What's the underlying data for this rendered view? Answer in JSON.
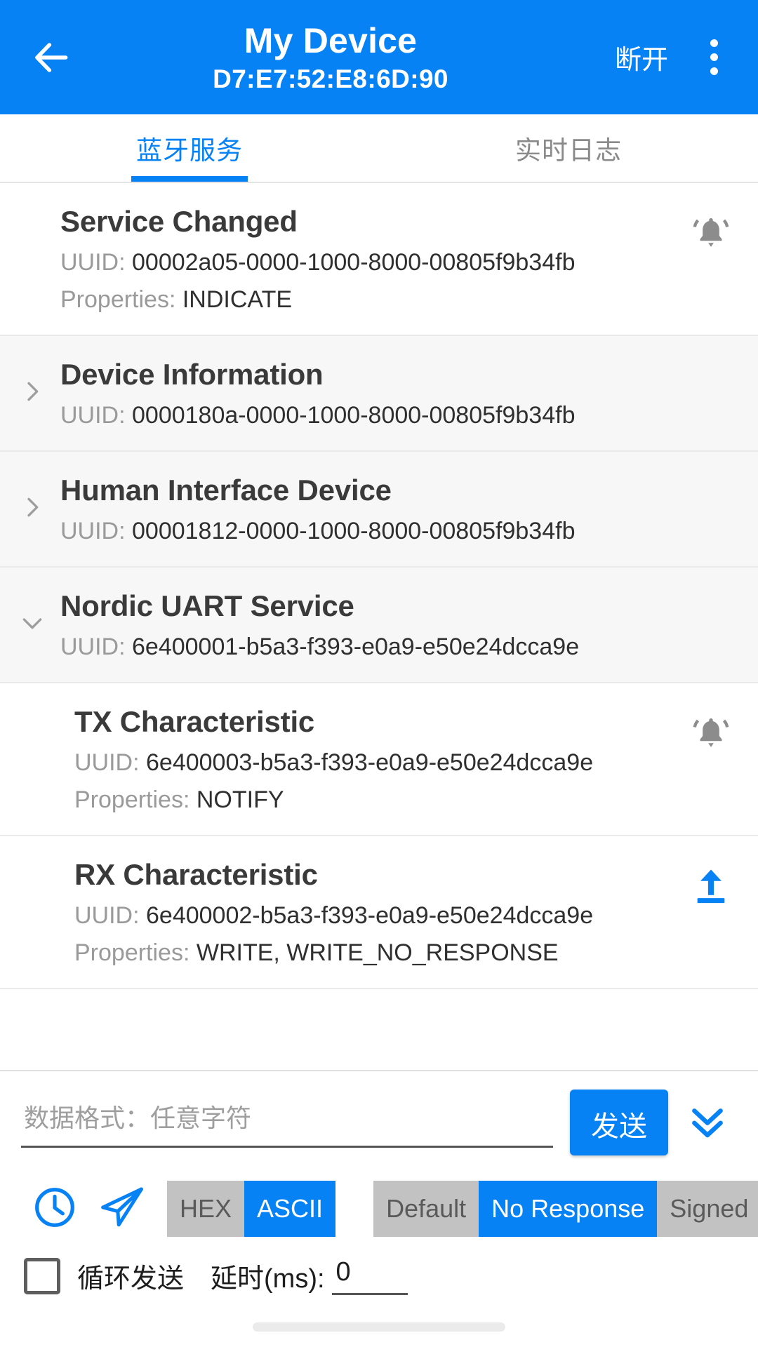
{
  "appbar": {
    "back_icon": "arrow-left-icon",
    "title": "My Device",
    "subtitle": "D7:E7:52:E8:6D:90",
    "disconnect_label": "断开",
    "overflow_icon": "more-vertical-icon",
    "background_color": "#0782f5"
  },
  "tabs": [
    {
      "label": "蓝牙服务",
      "active": true
    },
    {
      "label": "实时日志",
      "active": false
    }
  ],
  "services": [
    {
      "name": "Service Changed",
      "uuid_label": "UUID:",
      "uuid": "00002a05-0000-1000-8000-00805f9b34fb",
      "properties_label": "Properties:",
      "properties": "INDICATE",
      "action_icon": "bell-ring-icon",
      "action_color": "#8c8c8c",
      "chevron": "",
      "shaded": false,
      "indented": false
    },
    {
      "name": "Device Information",
      "uuid_label": "UUID:",
      "uuid": "0000180a-0000-1000-8000-00805f9b34fb",
      "properties_label": "",
      "properties": "",
      "action_icon": "",
      "action_color": "",
      "chevron": "chevron-right-icon",
      "shaded": true,
      "indented": false
    },
    {
      "name": "Human Interface Device",
      "uuid_label": "UUID:",
      "uuid": "00001812-0000-1000-8000-00805f9b34fb",
      "properties_label": "",
      "properties": "",
      "action_icon": "",
      "action_color": "",
      "chevron": "chevron-right-icon",
      "shaded": true,
      "indented": false
    },
    {
      "name": "Nordic UART Service",
      "uuid_label": "UUID:",
      "uuid": "6e400001-b5a3-f393-e0a9-e50e24dcca9e",
      "properties_label": "",
      "properties": "",
      "action_icon": "",
      "action_color": "",
      "chevron": "chevron-down-icon",
      "shaded": true,
      "indented": false
    },
    {
      "name": "TX Characteristic",
      "uuid_label": "UUID:",
      "uuid": "6e400003-b5a3-f393-e0a9-e50e24dcca9e",
      "properties_label": "Properties:",
      "properties": "NOTIFY",
      "action_icon": "bell-ring-icon",
      "action_color": "#8c8c8c",
      "chevron": "",
      "shaded": false,
      "indented": true
    },
    {
      "name": "RX Characteristic",
      "uuid_label": "UUID:",
      "uuid": "6e400002-b5a3-f393-e0a9-e50e24dcca9e",
      "properties_label": "Properties:",
      "properties": "WRITE, WRITE_NO_RESPONSE",
      "action_icon": "upload-icon",
      "action_color": "#0782f5",
      "chevron": "",
      "shaded": false,
      "indented": true
    }
  ],
  "send_panel": {
    "input_placeholder": "数据格式：任意字符",
    "input_value": "",
    "send_label": "发送",
    "expand_icon": "double-chevron-down-icon",
    "history_icon": "clock-icon",
    "quick_send_icon": "paper-plane-icon",
    "format_segments": [
      {
        "label": "HEX",
        "active": false
      },
      {
        "label": "ASCII",
        "active": true
      }
    ],
    "write_type_segments": [
      {
        "label": "Default",
        "active": false
      },
      {
        "label": "No Response",
        "active": true
      },
      {
        "label": "Signed",
        "active": false
      }
    ],
    "loop_checkbox_checked": false,
    "loop_label": "循环发送",
    "delay_label": "延时(ms):",
    "delay_value": "0"
  },
  "accent_color": "#0782f5"
}
